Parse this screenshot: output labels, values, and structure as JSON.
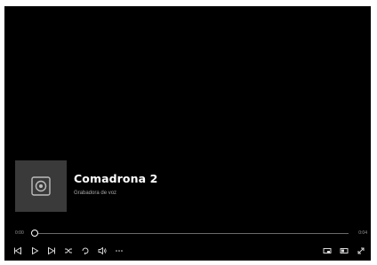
{
  "track": {
    "title": "Comadrona 2",
    "subtitle": "Grabadora de voz"
  },
  "playback": {
    "elapsed": "0:00",
    "total": "0:04",
    "progress": 0.0
  },
  "controls": {
    "left": [
      "previous-icon",
      "play-icon",
      "next-icon",
      "shuffle-icon",
      "repeat-icon",
      "volume-icon",
      "more-icon"
    ],
    "right": [
      "miniplayer-icon",
      "cast-icon",
      "fullscreen-icon"
    ]
  },
  "colors": {
    "background": "#000000",
    "art_tile": "#3a3a3a",
    "text_primary": "#ffffff",
    "text_secondary": "#a8a8a8"
  }
}
